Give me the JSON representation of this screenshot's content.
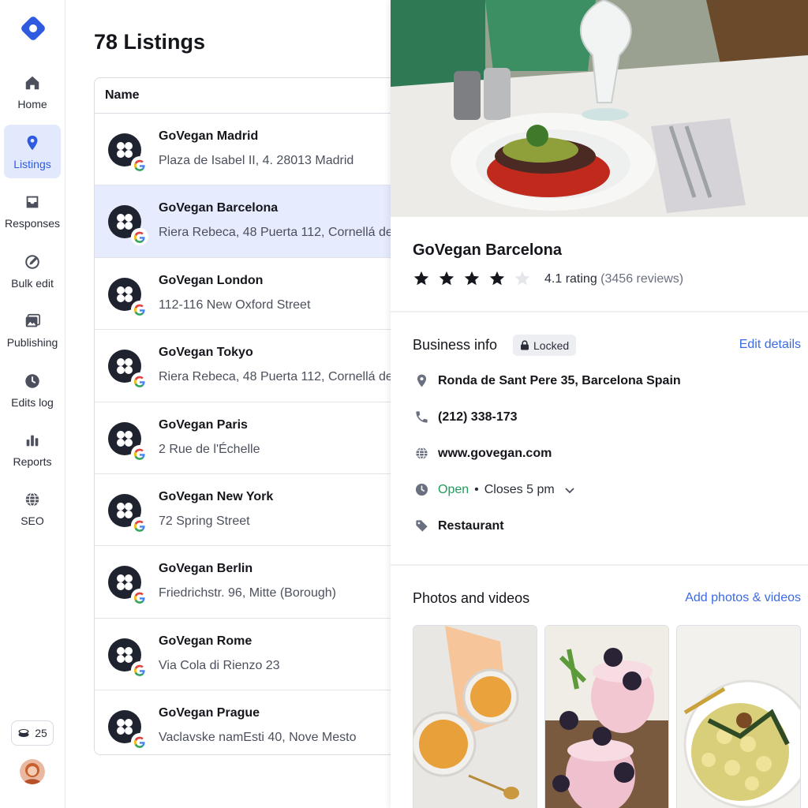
{
  "sidebar": {
    "items": [
      {
        "label": "Home",
        "icon": "home-icon"
      },
      {
        "label": "Listings",
        "icon": "location-pin-icon",
        "active": true
      },
      {
        "label": "Responses",
        "icon": "inbox-icon"
      },
      {
        "label": "Bulk edit",
        "icon": "edit-circle-icon"
      },
      {
        "label": "Publishing",
        "icon": "images-icon"
      },
      {
        "label": "Edits log",
        "icon": "clock-icon"
      },
      {
        "label": "Reports",
        "icon": "bar-chart-icon"
      },
      {
        "label": "SEO",
        "icon": "globe-icon"
      }
    ],
    "credits": "25"
  },
  "main": {
    "title": "78 Listings",
    "table_header": "Name",
    "rows": [
      {
        "name": "GoVegan Madrid",
        "address": "Plaza de Isabel II, 4. 28013 Madrid"
      },
      {
        "name": "GoVegan Barcelona",
        "address": "Riera Rebeca, 48 Puerta 112, Cornellá de",
        "selected": true
      },
      {
        "name": "GoVegan London",
        "address": "112-116 New Oxford Street"
      },
      {
        "name": "GoVegan Tokyo",
        "address": "Riera Rebeca, 48 Puerta 112, Cornellá de"
      },
      {
        "name": "GoVegan Paris",
        "address": "2 Rue de l'Échelle"
      },
      {
        "name": "GoVegan New York",
        "address": "72 Spring Street"
      },
      {
        "name": "GoVegan Berlin",
        "address": "Friedrichstr. 96, Mitte (Borough)"
      },
      {
        "name": "GoVegan Rome",
        "address": "Via Cola di Rienzo 23"
      },
      {
        "name": "GoVegan Prague",
        "address": "Vaclavske namEsti 40, Nove Mesto"
      }
    ]
  },
  "detail": {
    "name": "GoVegan Barcelona",
    "rating": 4.1,
    "rating_text": "4.1 rating",
    "reviews_text": "(3456 reviews)",
    "business_info": {
      "title": "Business info",
      "locked_label": "Locked",
      "edit_link": "Edit details",
      "address": "Ronda de Sant Pere 35, Barcelona Spain",
      "phone": "(212) 338-173",
      "website": "www.govegan.com",
      "open_status": "Open",
      "separator": "•",
      "closes": "Closes 5 pm",
      "category": "Restaurant"
    },
    "photos": {
      "title": "Photos and videos",
      "add_link": "Add photos & videos"
    }
  },
  "colors": {
    "accent": "#2f5be0",
    "active_bg": "#e3e9fc",
    "open_green": "#1e9e5a",
    "link_blue": "#3a6ae6"
  }
}
